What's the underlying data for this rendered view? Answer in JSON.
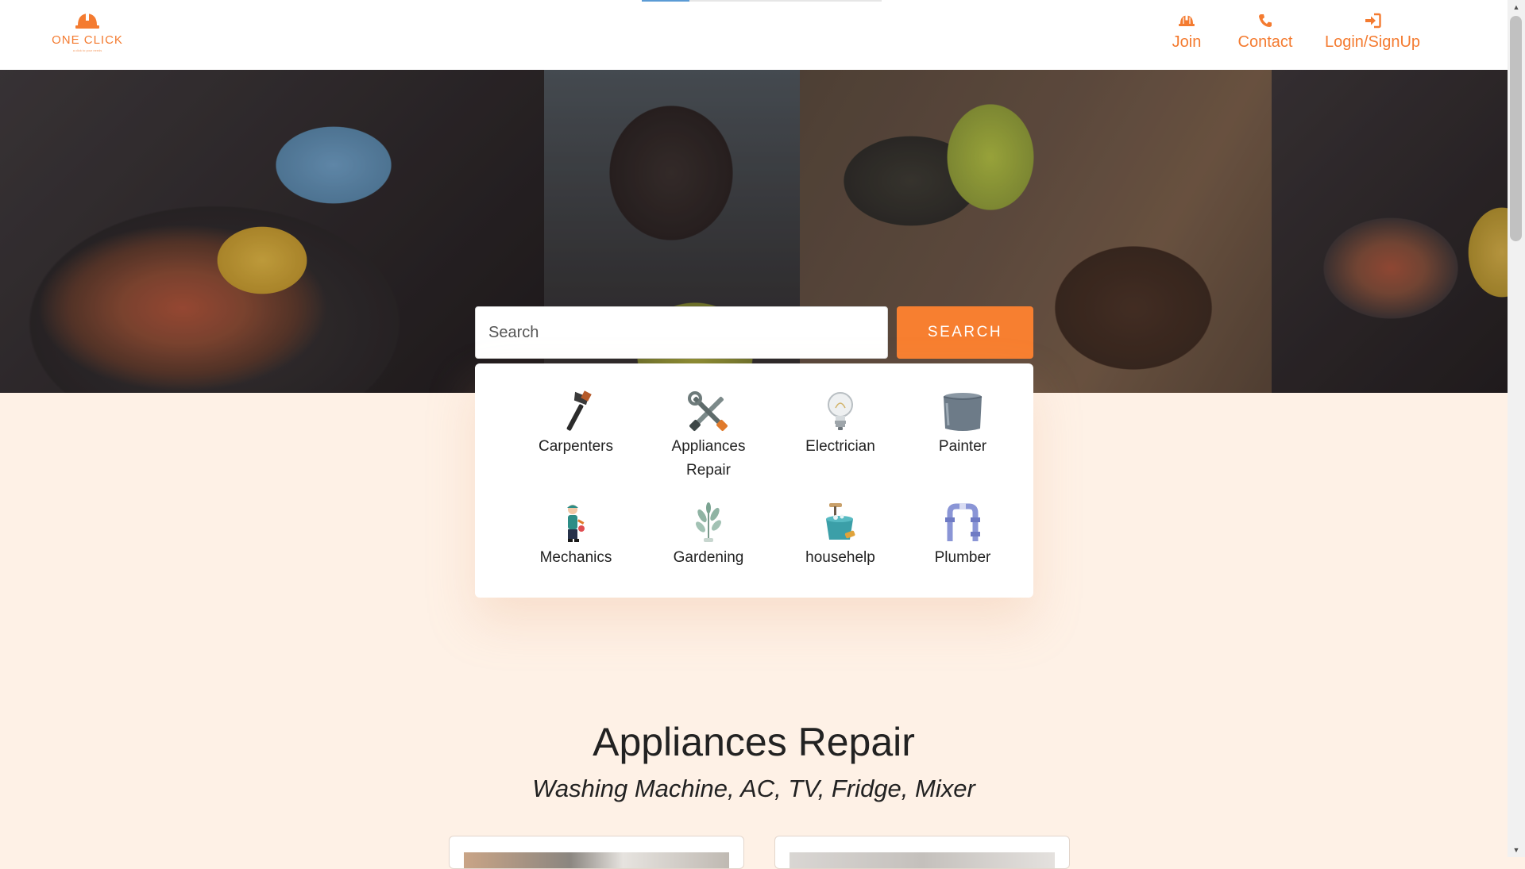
{
  "brand": {
    "name": "ONE CLICK",
    "tagline": "a click to your needs"
  },
  "nav": {
    "items": [
      {
        "label": "Join",
        "icon": "hard-hat-icon"
      },
      {
        "label": "Contact",
        "icon": "phone-icon"
      },
      {
        "label": "Login/SignUp",
        "icon": "sign-in-icon"
      }
    ]
  },
  "search": {
    "placeholder": "Search",
    "value": "",
    "button_label": "SEARCH"
  },
  "categories": [
    {
      "label": "Carpenters",
      "icon": "hammer-icon"
    },
    {
      "label": "Appliances Repair",
      "icon": "tools-icon"
    },
    {
      "label": "Electrician",
      "icon": "lightbulb-icon"
    },
    {
      "label": "Painter",
      "icon": "paint-bucket-icon"
    },
    {
      "label": "Mechanics",
      "icon": "mechanic-icon"
    },
    {
      "label": "Gardening",
      "icon": "plant-icon"
    },
    {
      "label": "househelp",
      "icon": "cleaning-bucket-icon"
    },
    {
      "label": "Plumber",
      "icon": "pipe-icon"
    }
  ],
  "section": {
    "title": "Appliances Repair",
    "subtitle": "Washing Machine, AC, TV, Fridge, Mixer"
  },
  "colors": {
    "accent": "#f77f30",
    "nav_text": "#f47b30",
    "page_bg": "#fef1e6"
  }
}
